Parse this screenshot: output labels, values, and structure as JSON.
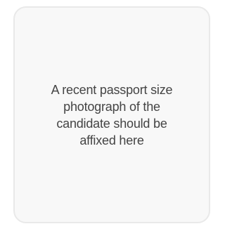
{
  "photo_placeholder": {
    "instruction": "A recent passport size photograph of the candidate should be affixed here"
  }
}
